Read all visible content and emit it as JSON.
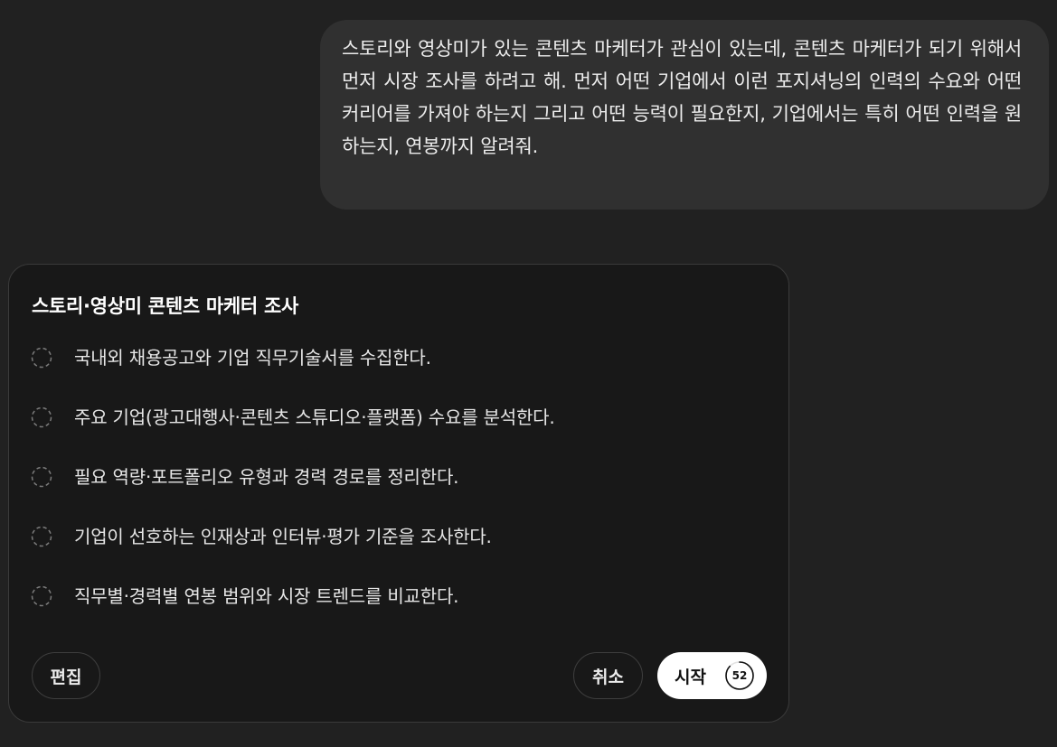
{
  "user_message": {
    "text": "스토리와 영상미가 있는 콘텐츠 마케터가 관심이 있는데, 콘텐츠 마케터가 되기 위해서 먼저 시장 조사를 하려고 해. 먼저 어떤 기업에서 이런 포지셔닝의 인력의 수요와 어떤 커리어를 가져야 하는지 그리고 어떤 능력이 필요한지, 기업에서는 특히 어떤 인력을 원하는지, 연봉까지 알려줘."
  },
  "plan": {
    "title": "스토리·영상미 콘텐츠 마케터 조사",
    "steps": [
      {
        "label": "국내외 채용공고와 기업 직무기술서를 수집한다.",
        "icon": "pending-circle-icon"
      },
      {
        "label": "주요 기업(광고대행사·콘텐츠 스튜디오·플랫폼) 수요를 분석한다.",
        "icon": "pending-circle-icon"
      },
      {
        "label": "필요 역량·포트폴리오 유형과 경력 경로를 정리한다.",
        "icon": "pending-circle-icon"
      },
      {
        "label": "기업이 선호하는 인재상과 인터뷰·평가 기준을 조사한다.",
        "icon": "pending-circle-icon"
      },
      {
        "label": "직무별·경력별 연봉 범위와 시장 트렌드를 비교한다.",
        "icon": "pending-circle-icon"
      }
    ],
    "buttons": {
      "edit_label": "편집",
      "cancel_label": "취소",
      "start_label": "시작",
      "countdown": "52",
      "countdown_fraction": 0.87
    }
  },
  "colors": {
    "background": "#212121",
    "user_bubble": "#303030",
    "card": "#181818",
    "card_border": "#3a3a3a",
    "start_button": "#ffffff"
  }
}
